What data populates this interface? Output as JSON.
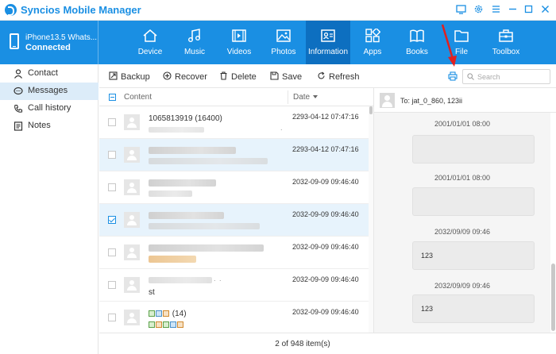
{
  "app": {
    "title": "Syncios Mobile Manager"
  },
  "window_controls": [
    "feedback-icon",
    "settings-icon",
    "menu-icon",
    "minimize-icon",
    "maximize-icon",
    "close-icon"
  ],
  "device": {
    "name": "iPhone13.5 Whats...",
    "status": "Connected"
  },
  "nav_tabs": [
    {
      "label": "Device",
      "icon": "home-icon"
    },
    {
      "label": "Music",
      "icon": "music-icon"
    },
    {
      "label": "Videos",
      "icon": "video-icon"
    },
    {
      "label": "Photos",
      "icon": "photo-icon"
    },
    {
      "label": "Information",
      "icon": "contact-card-icon",
      "active": true
    },
    {
      "label": "Apps",
      "icon": "apps-icon"
    },
    {
      "label": "Books",
      "icon": "book-icon"
    },
    {
      "label": "File",
      "icon": "folder-icon"
    },
    {
      "label": "Toolbox",
      "icon": "toolbox-icon"
    }
  ],
  "sidebar": {
    "items": [
      {
        "label": "Contact",
        "icon": "person-icon"
      },
      {
        "label": "Messages",
        "icon": "chat-icon",
        "active": true
      },
      {
        "label": "Call history",
        "icon": "phone-icon"
      },
      {
        "label": "Notes",
        "icon": "notes-icon"
      }
    ]
  },
  "toolbar": {
    "backup": "Backup",
    "recover": "Recover",
    "delete": "Delete",
    "save": "Save",
    "refresh": "Refresh",
    "search_placeholder": "Search"
  },
  "table": {
    "col_content": "Content",
    "col_date": "Date",
    "rows": [
      {
        "title": "1065813919 (16400)",
        "date": "2293-04-12 07:47:16",
        "checked": false,
        "selected": false
      },
      {
        "title": "",
        "date": "2293-04-12 07:47:16",
        "checked": false,
        "selected": true
      },
      {
        "title": "",
        "date": "2032-09-09 09:46:40",
        "checked": false,
        "selected": false
      },
      {
        "title": "",
        "date": "2032-09-09 09:46:40",
        "checked": true,
        "selected": true
      },
      {
        "title": "",
        "date": "2032-09-09 09:46:40",
        "checked": false,
        "selected": false
      },
      {
        "title": "",
        "sub": "st",
        "date": "2032-09-09 09:46:40",
        "checked": false,
        "selected": false
      },
      {
        "title": "(14)",
        "date": "2032-09-09 09:46:40",
        "checked": false,
        "selected": false
      }
    ]
  },
  "footer": {
    "count_text": "2 of 948 item(s)"
  },
  "conversation": {
    "to": "To: jat_0_860, 123ii",
    "messages": [
      {
        "time": "2001/01/01 08:00",
        "text": ""
      },
      {
        "time": "2001/01/01 08:00",
        "text": ""
      },
      {
        "time": "2032/09/09 09:46",
        "text": "123"
      },
      {
        "time": "2032/09/09 09:46",
        "text": "123"
      }
    ]
  },
  "colors": {
    "accent": "#1a8fe3",
    "active_tab": "#0d6fc0",
    "selected_row": "#e7f3fc",
    "annotation_arrow": "#e02020"
  }
}
